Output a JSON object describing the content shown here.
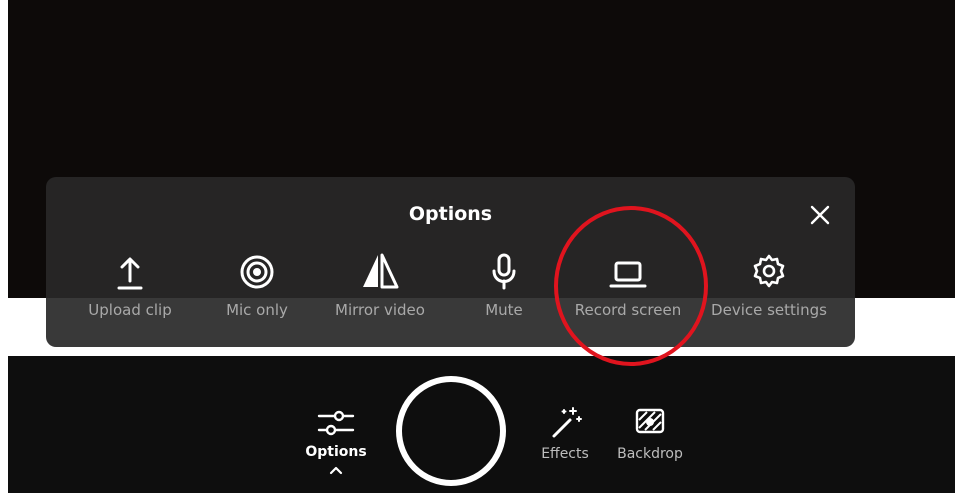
{
  "panel": {
    "title": "Options",
    "close_icon": "close-icon",
    "items": [
      {
        "label": "Upload clip",
        "icon": "upload-icon"
      },
      {
        "label": "Mic only",
        "icon": "mic-only-icon"
      },
      {
        "label": "Mirror video",
        "icon": "mirror-icon"
      },
      {
        "label": "Mute",
        "icon": "microphone-icon"
      },
      {
        "label": "Record screen",
        "icon": "laptop-icon"
      },
      {
        "label": "Device settings",
        "icon": "gear-icon"
      }
    ]
  },
  "toolbar": {
    "options_label": "Options",
    "effects_label": "Effects",
    "backdrop_label": "Backdrop",
    "record_button_icon": "record-button"
  },
  "colors": {
    "panel_bg": "#282828",
    "highlight_ring": "#e0141e",
    "label_text": "#a9a9a9",
    "title_text": "#ffffff"
  }
}
